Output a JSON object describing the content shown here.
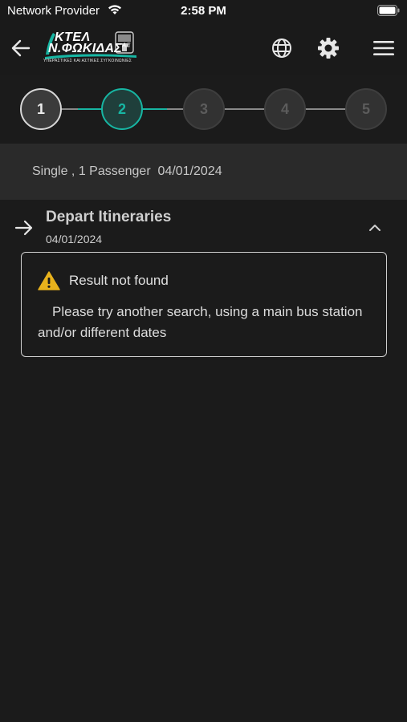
{
  "status_bar": {
    "provider": "Network Provider",
    "time": "2:58 PM"
  },
  "header": {
    "logo": {
      "line1": "ΚΤΕΛ",
      "line2": "Ν.ΦΩΚΙΔΑΣ",
      "line2_suffix": "ΑΕ",
      "tagline": "ΥΠΕΡΑΣΤΙΚΕΣ ΚΑΙ ΑΣΤΙΚΕΣ ΣΥΓΚΟΙΝΩΝΙΕΣ"
    },
    "icons": [
      "back-arrow-icon",
      "globe-icon",
      "gear-icon",
      "hamburger-menu-icon"
    ]
  },
  "stepper": {
    "steps": [
      {
        "label": "1",
        "state": "done"
      },
      {
        "label": "2",
        "state": "active"
      },
      {
        "label": "3",
        "state": "todo"
      },
      {
        "label": "4",
        "state": "todo"
      },
      {
        "label": "5",
        "state": "todo"
      }
    ]
  },
  "summary": {
    "text": "Single , 1 Passenger  04/01/2024"
  },
  "itineraries": {
    "title": "Depart Itineraries",
    "date": "04/01/2024",
    "result": {
      "title": "Result not found",
      "message": "Please try another search, using a main bus station and/or different dates"
    }
  },
  "colors": {
    "accent": "#17b6a3",
    "background": "#1b1b1b",
    "summary_bg": "#2a2a2a",
    "warning": "#e8b21c"
  }
}
